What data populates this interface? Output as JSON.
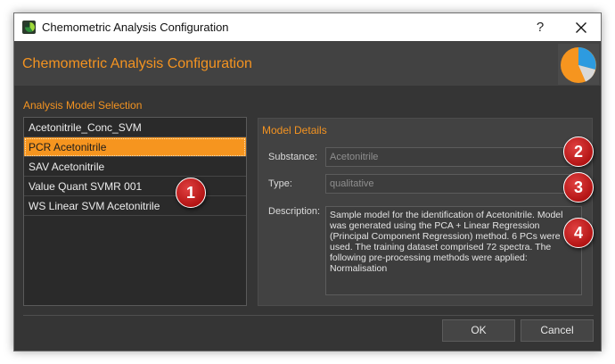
{
  "window": {
    "title": "Chemometric Analysis Configuration",
    "help_label": "?"
  },
  "header": {
    "heading": "Chemometric Analysis Configuration"
  },
  "model_selection": {
    "title": "Analysis Model Selection",
    "items": [
      {
        "label": "Acetonitrile_Conc_SVM",
        "selected": false
      },
      {
        "label": "PCR Acetonitrile",
        "selected": true
      },
      {
        "label": "SAV Acetonitrile",
        "selected": false
      },
      {
        "label": "Value Quant SVMR 001",
        "selected": false
      },
      {
        "label": "WS Linear SVM Acetonitrile",
        "selected": false
      }
    ]
  },
  "details": {
    "title": "Model Details",
    "substance_label": "Substance:",
    "substance_value": "Acetonitrile",
    "type_label": "Type:",
    "type_value": "qualitative",
    "description_label": "Description:",
    "description_value": "Sample model for the identification of Acetonitrile. Model was generated using the PCA  + Linear Regression (Principal Component Regression) method. 6 PCs were used. The training dataset comprised 72 spectra. The following pre-processing methods were applied: Normalisation"
  },
  "callouts": [
    "1",
    "2",
    "3",
    "4"
  ],
  "buttons": {
    "ok": "OK",
    "cancel": "Cancel"
  },
  "colors": {
    "accent": "#f39321",
    "selection": "#f6951f",
    "background": "#353535",
    "panel": "#424242",
    "badge": "#c41e1e"
  }
}
